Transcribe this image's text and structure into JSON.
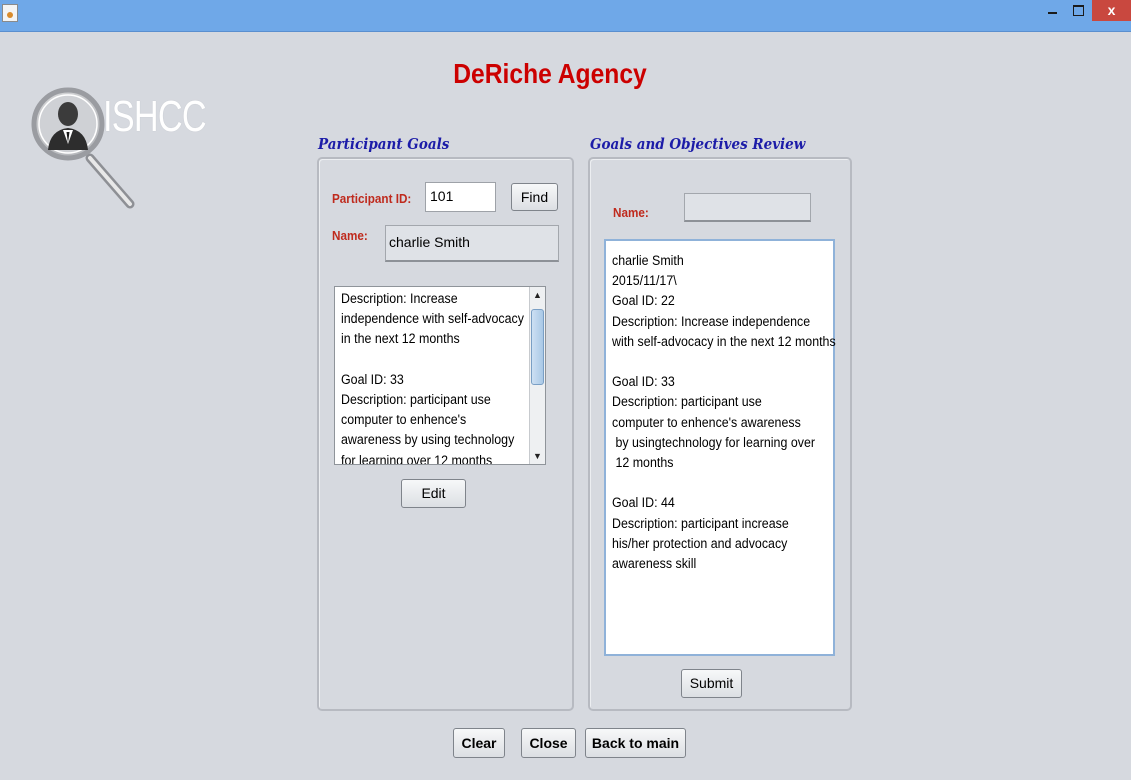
{
  "window": {
    "close_symbol": "x",
    "icons": [
      "java-icon",
      "minimize-icon",
      "maximize-icon",
      "close-icon"
    ]
  },
  "logo": {
    "text": "ISHCC"
  },
  "app_title": "DeRiche Agency",
  "participant_goals": {
    "title": "Participant Goals",
    "id_label": "Participant ID:",
    "id_value": "101",
    "find_label": "Find",
    "name_label": "Name:",
    "name_value": "charlie Smith",
    "goals_text": "Description: Increase\nindependence with self-advocacy\nin the next 12 months\n\nGoal ID: 33\nDescription: participant use\ncomputer to enhence's\nawareness by using technology\nfor learning over 12 months",
    "edit_label": "Edit"
  },
  "review": {
    "title": "Goals and Objectives Review",
    "name_label": "Name:",
    "name_value": "",
    "review_text": "charlie Smith\n2015/11/17\\\nGoal ID: 22\nDescription: Increase independence\nwith self-advocacy in the next 12 months\n\nGoal ID: 33\nDescription: participant use\ncomputer to enhence's awareness\n by usingtechnology for learning over\n 12 months\n\nGoal ID: 44\nDescription: participant increase\nhis/her protection and advocacy\nawareness skill",
    "submit_label": "Submit"
  },
  "footer": {
    "clear_label": "Clear",
    "close_label": "Close",
    "back_label": "Back to main"
  },
  "colors": {
    "title_red": "#cc0000",
    "section_blue": "#1c1ca8",
    "label_red": "#bf2a1d",
    "titlebar_blue": "#6fa8e8",
    "close_red": "#c9483f",
    "background": "#d6d9df"
  }
}
